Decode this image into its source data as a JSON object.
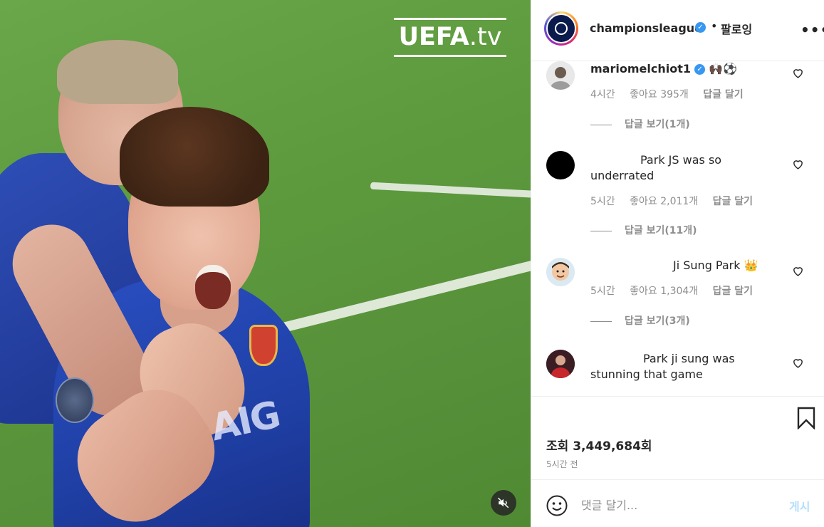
{
  "media": {
    "watermark": {
      "bold": "UEFA",
      "thin": ".tv"
    },
    "sponsor_text": "AIG",
    "mute_icon": "speaker-muted-icon"
  },
  "post": {
    "owner": "championsleague",
    "owner_verified": true,
    "follow_dot": "•",
    "follow_status": "팔로잉",
    "more_icon": "•••",
    "view_count": "조회 3,449,684회",
    "time_ago": "5시간 전"
  },
  "comments": [
    {
      "user": "mariomelchiot1",
      "verified": true,
      "text": "🙌🏿⚽",
      "time": "4시간",
      "likes": "좋아요 395개",
      "reply_label": "답글 달기",
      "view_replies": "답글 보기(1개)",
      "avatar": "photo-avatar"
    },
    {
      "user": "",
      "verified": false,
      "text": "Park JS was so underrated",
      "time": "5시간",
      "likes": "좋아요 2,011개",
      "reply_label": "답글 달기",
      "view_replies": "답글 보기(11개)",
      "avatar": "black-avatar"
    },
    {
      "user": "",
      "verified": false,
      "text": "Ji Sung Park 👑",
      "time": "5시간",
      "likes": "좋아요 1,304개",
      "reply_label": "답글 달기",
      "view_replies": "답글 보기(3개)",
      "avatar": "memoji-avatar"
    },
    {
      "user": "",
      "verified": false,
      "text": "Park ji sung was stunning that game",
      "avatar": "photo-avatar"
    }
  ],
  "compose": {
    "placeholder": "댓글 달기...",
    "post_label": "게시"
  },
  "colors": {
    "verified": "#3897f0",
    "muted_text": "#8e8e8e",
    "post_button": "#b2dffc"
  }
}
